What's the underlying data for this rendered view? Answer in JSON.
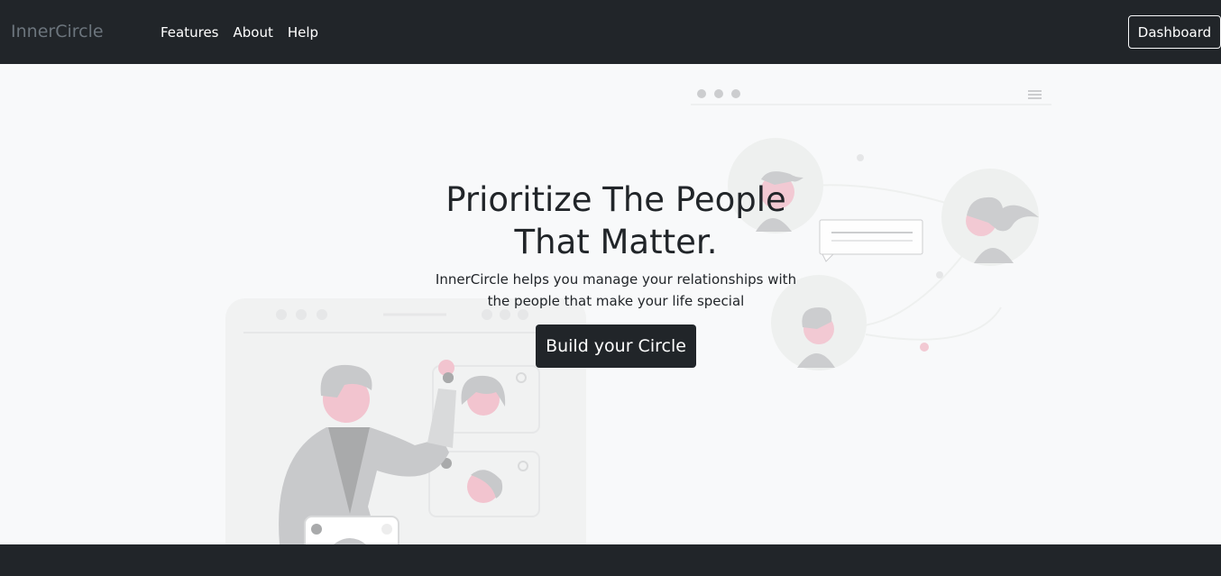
{
  "navbar": {
    "brand": "InnerCircle",
    "links": [
      {
        "label": "Features"
      },
      {
        "label": "About"
      },
      {
        "label": "Help"
      }
    ],
    "dashboard_label": "Dashboard"
  },
  "hero": {
    "headline": "Prioritize The People That Matter.",
    "lead": "InnerCircle helps you manage your relationships with the people that make your life special",
    "cta_label": "Build your Circle"
  },
  "colors": {
    "navbar_bg": "#212529",
    "page_bg": "#f8f9fa",
    "illustration_gray": "#c8c9cb",
    "accent_pink": "#f2c4cf"
  }
}
